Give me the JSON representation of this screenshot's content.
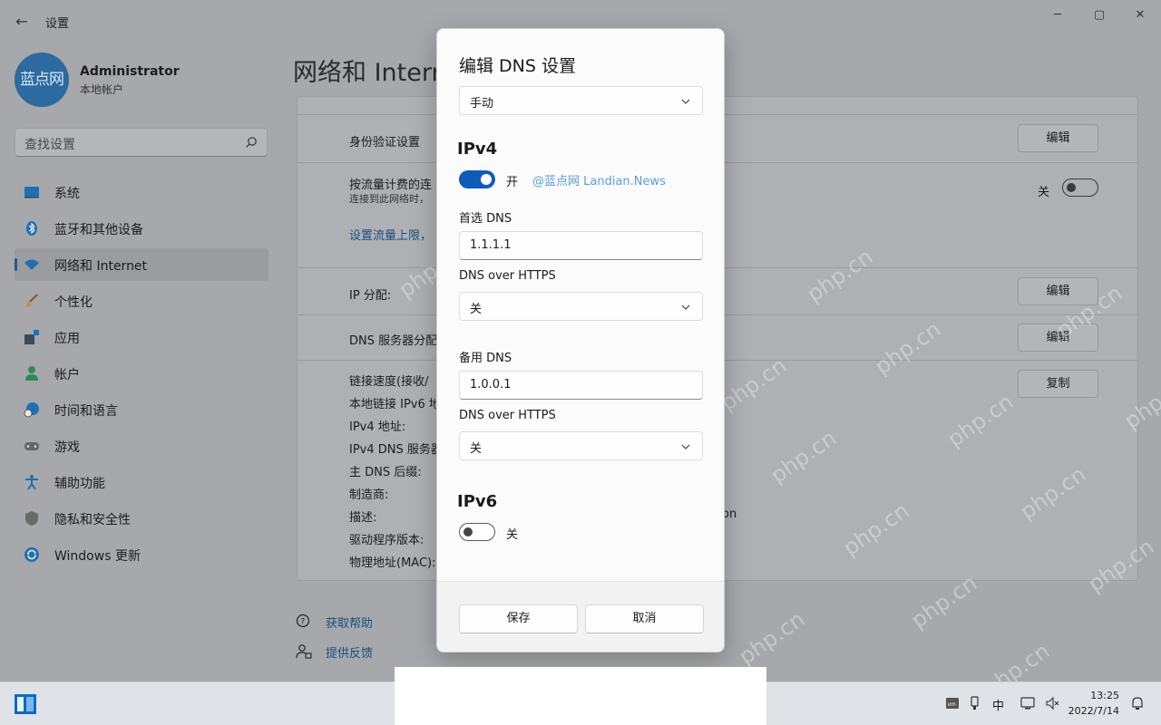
{
  "window": {
    "app_title": "设置",
    "back_glyph": "←",
    "minimize_glyph": "─",
    "maximize_glyph": "▢",
    "close_glyph": "✕"
  },
  "user": {
    "avatar_text": "蓝点网",
    "name": "Administrator",
    "account_type": "本地帐户"
  },
  "search": {
    "placeholder": "查找设置",
    "icon": "search-icon"
  },
  "nav": {
    "items": [
      {
        "label": "系统",
        "icon": "monitor-icon",
        "color": "#1f6fb5"
      },
      {
        "label": "蓝牙和其他设备",
        "icon": "bluetooth-icon",
        "color": "#1f6fb5"
      },
      {
        "label": "网络和 Internet",
        "icon": "wifi-icon",
        "color": "#1f6fb5",
        "active": true
      },
      {
        "label": "个性化",
        "icon": "brush-icon",
        "color": "#b5651d"
      },
      {
        "label": "应用",
        "icon": "apps-icon",
        "color": "#3a4a5a"
      },
      {
        "label": "帐户",
        "icon": "person-icon",
        "color": "#2e8b57"
      },
      {
        "label": "时间和语言",
        "icon": "globe-clock-icon",
        "color": "#1f6fb5"
      },
      {
        "label": "游戏",
        "icon": "gamepad-icon",
        "color": "#555"
      },
      {
        "label": "辅助功能",
        "icon": "accessibility-icon",
        "color": "#1f6fb5"
      },
      {
        "label": "隐私和安全性",
        "icon": "shield-icon",
        "color": "#555"
      },
      {
        "label": "Windows 更新",
        "icon": "update-icon",
        "color": "#1f6fb5"
      }
    ]
  },
  "main": {
    "page_title": "网络和 Internet",
    "auth_label": "身份验证设置",
    "auth_button": "编辑",
    "metered_label": "按流量计费的连",
    "metered_sub": "连接到此网络时，",
    "metered_state": "关",
    "data_limit_link": "设置流量上限，",
    "ip_label": "IP 分配:",
    "ip_button": "编辑",
    "dns_label": "DNS 服务器分配",
    "dns_button": "编辑",
    "props_button": "复制",
    "props": [
      "链接速度(接收/",
      "本地链接 IPv6 地",
      "IPv4 地址:",
      "IPv4 DNS 服务器",
      "主 DNS 后缀:",
      "制造商:",
      "描述:",
      "驱动程序版本:",
      "物理地址(MAC):"
    ],
    "desc_tail": "on"
  },
  "help": {
    "get_help": "获取帮助",
    "feedback": "提供反馈"
  },
  "dialog": {
    "title": "编辑 DNS 设置",
    "mode_value": "手动",
    "ipv4_title": "IPv4",
    "ipv4_state": "开",
    "credit": "@蓝点网 Landian.News",
    "preferred_label": "首选 DNS",
    "preferred_value": "1.1.1.1",
    "doh1_label": "DNS over HTTPS",
    "doh1_value": "关",
    "alternate_label": "备用 DNS",
    "alternate_value": "1.0.0.1",
    "doh2_label": "DNS over HTTPS",
    "doh2_value": "关",
    "ipv6_title": "IPv6",
    "ipv6_state": "关",
    "save": "保存",
    "cancel": "取消"
  },
  "watermark": "php.cn",
  "taskbar": {
    "ime": "中",
    "time": "13:25",
    "date": "2022/7/14"
  },
  "colors": {
    "accent": "#0f5cb8",
    "link": "#5a9de0"
  }
}
